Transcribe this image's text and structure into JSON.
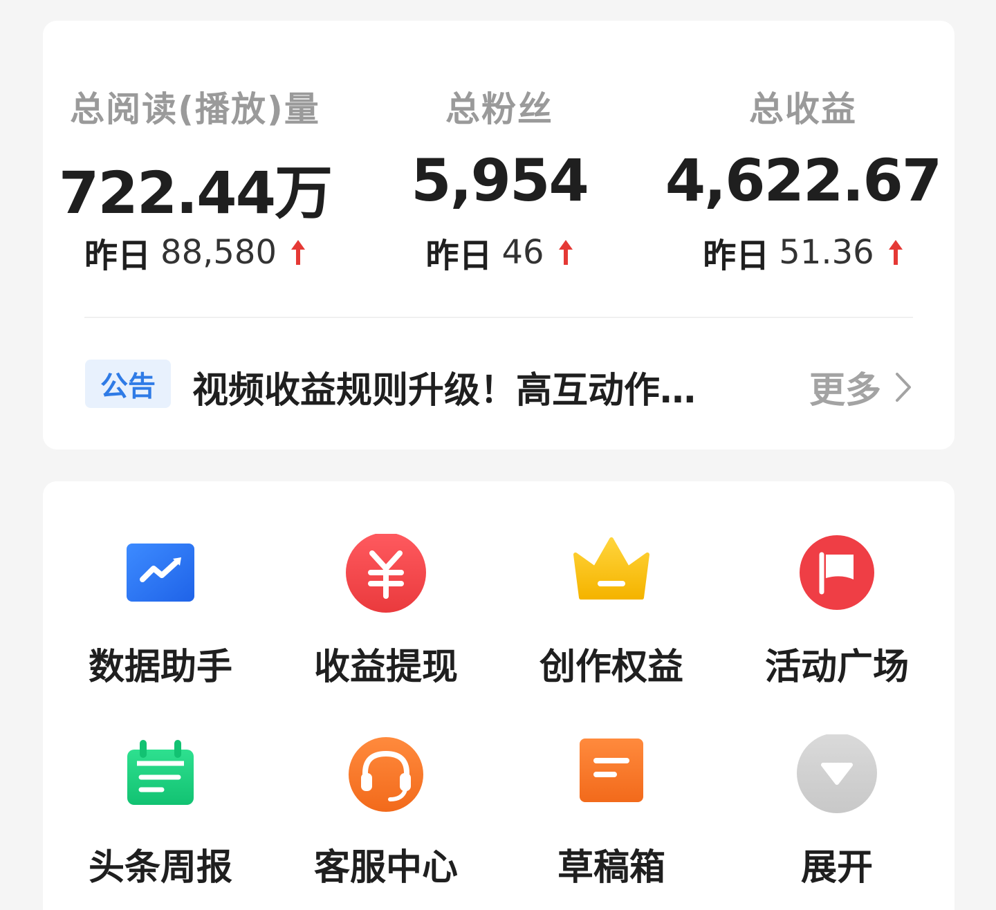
{
  "stats": [
    {
      "label": "总阅读(播放)量",
      "value": "722.44万",
      "yesterday_label": "昨日",
      "yesterday_value": "88,580",
      "trend_icon": "arrow-up-icon"
    },
    {
      "label": "总粉丝",
      "value": "5,954",
      "yesterday_label": "昨日",
      "yesterday_value": "46",
      "trend_icon": "arrow-up-icon"
    },
    {
      "label": "总收益",
      "value": "4,622.67",
      "yesterday_label": "昨日",
      "yesterday_value": "51.36",
      "trend_icon": "arrow-up-icon"
    }
  ],
  "notice": {
    "badge": "公告",
    "text": "视频收益规则升级！高互动作…",
    "more_label": "更多"
  },
  "tools": [
    {
      "label": "数据助手",
      "icon": "chart-trend-icon"
    },
    {
      "label": "收益提现",
      "icon": "yuan-coin-icon"
    },
    {
      "label": "创作权益",
      "icon": "crown-icon"
    },
    {
      "label": "活动广场",
      "icon": "flag-icon"
    },
    {
      "label": "头条周报",
      "icon": "calendar-icon"
    },
    {
      "label": "客服中心",
      "icon": "headset-icon"
    },
    {
      "label": "草稿箱",
      "icon": "draft-doc-icon"
    },
    {
      "label": "展开",
      "icon": "expand-down-icon"
    }
  ],
  "colors": {
    "up_arrow": "#e53935",
    "badge_bg": "#e8f1fd",
    "badge_text": "#2f7be6"
  }
}
